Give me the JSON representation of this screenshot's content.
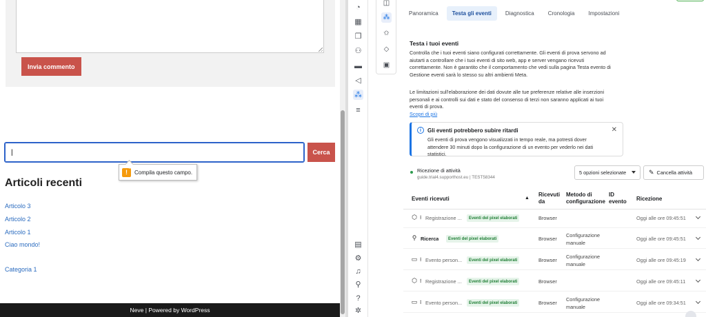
{
  "wordpress": {
    "submit_comment_label": "Invia commento",
    "search_value": "|",
    "search_button_label": "Cerca",
    "validation_message": "Compila questo campo.",
    "recent_posts_title": "Articoli recenti",
    "recent_posts": [
      "Articolo 3",
      "Articolo 2",
      "Articolo 1",
      "Ciao mondo!"
    ],
    "category": "Categoria 1",
    "footer_text": "Neve | Powered by WordPress"
  },
  "events_manager": {
    "tabs": [
      {
        "label": "Panoramica",
        "active": false
      },
      {
        "label": "Testa gli eventi",
        "active": true
      },
      {
        "label": "Diagnostica",
        "active": false
      },
      {
        "label": "Cronologia",
        "active": false
      },
      {
        "label": "Impostazioni",
        "active": false
      }
    ],
    "section_title": "Testa i tuoi eventi",
    "intro_text": "Controlla che i tuoi eventi siano configurati correttamente. Gli eventi di prova servono ad aiutarti a controllare che i tuoi eventi di sito web, app e server vengano ricevuti correttamente. Non è garantito che il comportamento che vedi sulla pagina Testa evento di Gestione eventi sarà lo stesso su altri ambienti Meta.",
    "limitations_text": "Le limitazioni sull'elaborazione dei dati dovute alle tue preferenze relative alle inserzioni personali e ai controlli sui dati e stato del consenso di terzi non saranno applicati ai tuoi eventi di prova.",
    "learn_more": "Scopri di più",
    "notice": {
      "title": "Gli eventi potrebbero subire ritardi",
      "body": "Gli eventi di prova vengono visualizzati in tempo reale, ma potresti dover attendere 30 minuti dopo la configurazione di un evento per vederlo nei dati statistici.",
      "close_glyph": "✕"
    },
    "activity": {
      "label": "Ricezione di attività",
      "source": "guide.trial4.supporthost.eu   |   TEST58344",
      "options_label": "5 opzioni selezionate",
      "cancel_label": "Cancella attività"
    },
    "table": {
      "headers": {
        "events": "Eventi ricevuti",
        "received_from": "Ricevuti da",
        "setup_method": "Metodo di configurazione",
        "event_id": "ID evento",
        "reception": "Ricezione"
      },
      "warning_glyph": "▲",
      "rows": [
        {
          "icon": "tag-icon",
          "glyph": "⬡",
          "prefix": "⁝",
          "name": "Registrazione ...",
          "badge": "Eventi del pixel elaborati",
          "source": "Browser",
          "method": "",
          "time": "Oggi alle ore 09:45:51",
          "strong": false
        },
        {
          "icon": "search-icon",
          "glyph": "⚲",
          "prefix": "",
          "name": "Ricerca",
          "badge": "Eventi del pixel elaborati",
          "source": "Browser",
          "method": "Configurazione manuale",
          "time": "Oggi alle ore 09:45:51",
          "strong": true
        },
        {
          "icon": "window-icon",
          "glyph": "▭",
          "prefix": "⁝",
          "name": "Evento person...",
          "badge": "Eventi del pixel elaborati",
          "source": "Browser",
          "method": "Configurazione manuale",
          "time": "Oggi alle ore 09:45:19",
          "strong": false
        },
        {
          "icon": "tag-icon",
          "glyph": "⬡",
          "prefix": "⁝",
          "name": "Registrazione ...",
          "badge": "Eventi del pixel elaborati",
          "source": "Browser",
          "method": "",
          "time": "Oggi alle ore 09:45:11",
          "strong": false
        },
        {
          "icon": "window-icon",
          "glyph": "▭",
          "prefix": "⁝",
          "name": "Evento person...",
          "badge": "Eventi del pixel elaborati",
          "source": "Browser",
          "method": "Configurazione manuale",
          "time": "Oggi alle ore 09:34:51",
          "strong": false
        }
      ]
    }
  },
  "colors": {
    "wp_accent": "#c9534b",
    "fb_blue": "#1b74e4",
    "badge_green": "#1e7e34"
  }
}
